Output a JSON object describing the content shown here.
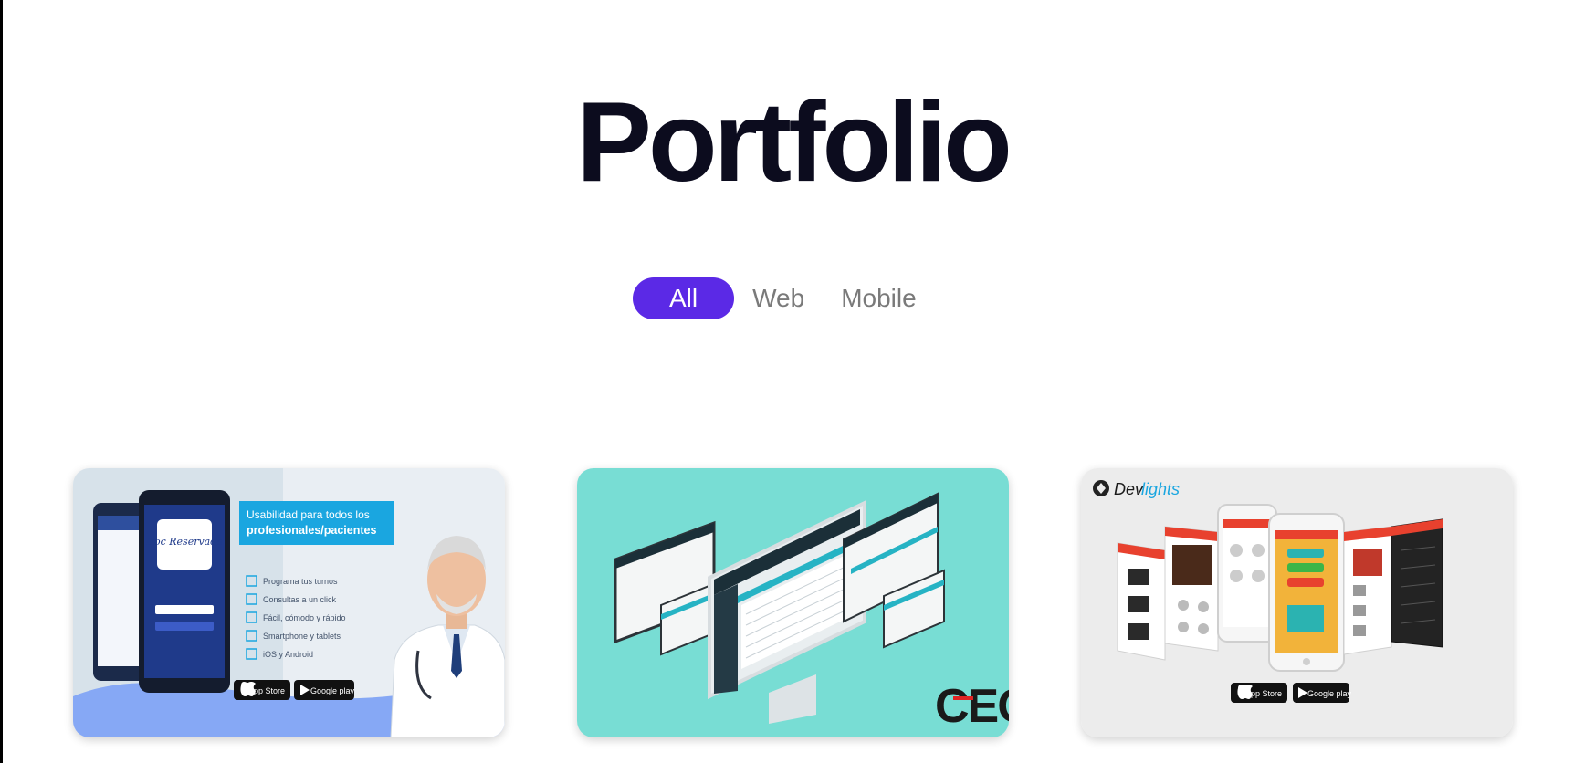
{
  "page": {
    "title": "Portfolio"
  },
  "filters": [
    {
      "label": "All",
      "active": true
    },
    {
      "label": "Web",
      "active": false
    },
    {
      "label": "Mobile",
      "active": false
    }
  ],
  "cards": [
    {
      "headline_line1": "Usabilidad para todos los",
      "headline_line2": "profesionales/pacientes",
      "features": [
        "Programa tus turnos",
        "Consultas a un click",
        "Fácil, cómodo y rápido",
        "Smartphone y tablets",
        "iOS y Android"
      ],
      "app_name": "Doc Reservada",
      "store_badges": [
        "App Store",
        "Google play"
      ]
    },
    {
      "logo_text": "CEO"
    },
    {
      "brand_prefix": "Dev",
      "brand_suffix": "lights",
      "store_badges": [
        "App Store",
        "Google play"
      ]
    }
  ],
  "colors": {
    "accent": "#5b29e6",
    "card2_bg": "#78ddd4",
    "card3_bg": "#ececec",
    "card1_banner": "#1aa6e0"
  }
}
